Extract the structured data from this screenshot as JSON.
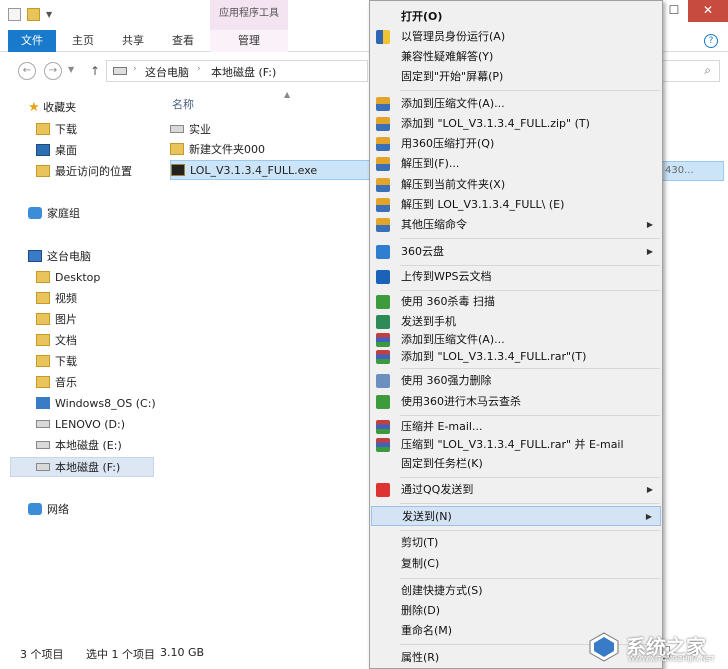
{
  "ribbon": {
    "context_group": "应用程序工具",
    "tabs": [
      "文件",
      "主页",
      "共享",
      "查看",
      "管理"
    ]
  },
  "address": {
    "crumbs": [
      "这台电脑",
      "本地磁盘 (F:)"
    ]
  },
  "nav": {
    "favorites": "收藏夹",
    "fav_items": [
      "下载",
      "桌面",
      "最近访问的位置"
    ],
    "homegroup": "家庭组",
    "thispc": "这台电脑",
    "pc_items": [
      "Desktop",
      "视频",
      "图片",
      "文档",
      "下载",
      "音乐",
      "Windows8_OS (C:)",
      "LENOVO (D:)",
      "本地磁盘 (E:)",
      "本地磁盘 (F:)"
    ],
    "network": "网络"
  },
  "files": {
    "column_name": "名称",
    "items": [
      "实业",
      "新建文件夹000",
      "LOL_V3.1.3.4_FULL.exe"
    ],
    "selected_trailing": "430..."
  },
  "status": {
    "count": "3 个项目",
    "selected": "选中 1 个项目",
    "size": "3.10 GB"
  },
  "menu": {
    "open": "打开(O)",
    "run_as_admin": "以管理员身份运行(A)",
    "compat": "兼容性疑难解答(Y)",
    "pin_start": "固定到\"开始\"屏幕(P)",
    "add_archive": "添加到压缩文件(A)...",
    "add_zip": "添加到 \"LOL_V3.1.3.4_FULL.zip\" (T)",
    "open_360": "用360压缩打开(Q)",
    "extract_to": "解压到(F)...",
    "extract_here": "解压到当前文件夹(X)",
    "extract_folder": "解压到 LOL_V3.1.3.4_FULL\\ (E)",
    "other_cmds": "其他压缩命令",
    "cloud360": "360云盘",
    "wps_upload": "上传到WPS云文档",
    "scan360": "使用 360杀毒 扫描",
    "send_phone": "发送到手机",
    "add_archive2": "添加到压缩文件(A)...",
    "add_rar": "添加到 \"LOL_V3.1.3.4_FULL.rar\"(T)",
    "force_delete": "使用 360强力删除",
    "trojan_scan": "使用360进行木马云查杀",
    "compress_email": "压缩并 E-mail...",
    "compress_rar_email": "压缩到 \"LOL_V3.1.3.4_FULL.rar\" 并 E-mail",
    "pin_taskbar": "固定到任务栏(K)",
    "qq_send": "通过QQ发送到",
    "send_to": "发送到(N)",
    "cut": "剪切(T)",
    "copy": "复制(C)",
    "create_shortcut": "创建快捷方式(S)",
    "delete": "删除(D)",
    "rename": "重命名(M)",
    "properties": "属性(R)"
  },
  "watermark": {
    "text": "系统之家",
    "url": "WWW.XITONGZHIJIA.NET"
  }
}
